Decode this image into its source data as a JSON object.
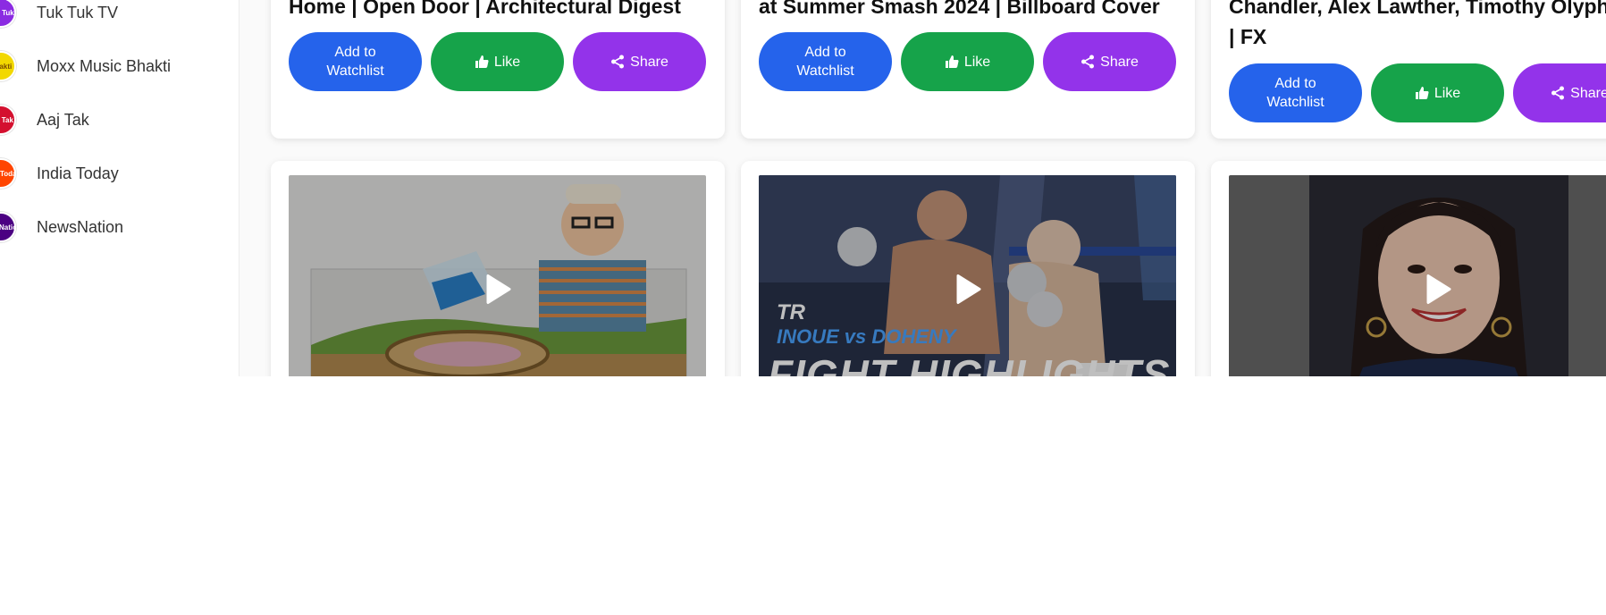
{
  "sidebar": {
    "channels": [
      {
        "name": "Tuk Tuk TV",
        "logo_text": "Tuk Tuk",
        "color": "#8b2be2",
        "icon": "tuk-tuk-tv-logo"
      },
      {
        "name": "Moxx Music Bhakti",
        "logo_text": "Bhakti",
        "color": "#f2d800",
        "icon": "moxx-music-bhakti-logo"
      },
      {
        "name": "Aaj Tak",
        "logo_text": "Aaj Tak",
        "color": "#d4102f",
        "icon": "aaj-tak-logo"
      },
      {
        "name": "India Today",
        "logo_text": "India Today",
        "color": "#ff4500",
        "icon": "india-today-logo"
      },
      {
        "name": "NewsNation",
        "logo_text": "NewsNation",
        "color": "#4b0082",
        "icon": "newsnation-logo"
      }
    ]
  },
  "cards_top": [
    {
      "title_lines": [
        "Home | Open Door | Architectural Digest"
      ]
    },
    {
      "title_lines": [
        "at Summer Smash 2024 | Billboard Cover"
      ]
    },
    {
      "title_lines": [
        "Chandler, Alex Lawther, Timothy Olyph",
        "| FX"
      ]
    }
  ],
  "buttons": {
    "watchlist_line1": "Add to",
    "watchlist_line2": "Watchlist",
    "like": "Like",
    "share": "Share"
  },
  "cards_bottom": [
    {
      "thumbnail": "man-with-aquarium-model-thumbnail",
      "play_icon": "play-icon"
    },
    {
      "thumbnail": "boxing-fight-highlights-thumbnail",
      "overlay_text": "FIGHT HIGHLIGHTS",
      "sub_text": "INOUE vs DOHENY",
      "brand": "TR",
      "play_icon": "play-icon"
    },
    {
      "thumbnail": "woman-portrait-thumbnail",
      "play_icon": "play-icon"
    }
  ],
  "colors": {
    "watchlist": "#2563eb",
    "like": "#16a34a",
    "share": "#9333ea"
  }
}
